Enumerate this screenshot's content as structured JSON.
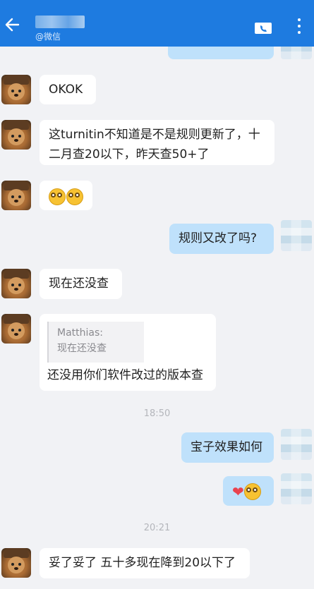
{
  "header": {
    "subtitle": "@微信"
  },
  "messages": {
    "m1": "OKOK",
    "m2_line1": "这turnitin不知道是不是规则更新了，十",
    "m2_line2": "二月查20以下，昨天查50+了",
    "m3_emoji": "dizzy-face-emoji x2",
    "m4": "规则又改了吗?",
    "m5": "现在还没查",
    "m6_quote_name": "Matthias:",
    "m6_quote_text": "现在还没查",
    "m6_text": "还没用你们软件改过的版本查",
    "time1": "18:50",
    "m7": "宝子效果如何",
    "m8_emoji": "heart + dizzy-face-emoji",
    "time2": "20:21",
    "m9": "妥了妥了 五十多现在降到20以下了"
  },
  "colors": {
    "header": "#1e7be0",
    "incoming": "#ffffff",
    "outgoing": "#bfe1fb",
    "background": "#f1f2f5"
  }
}
